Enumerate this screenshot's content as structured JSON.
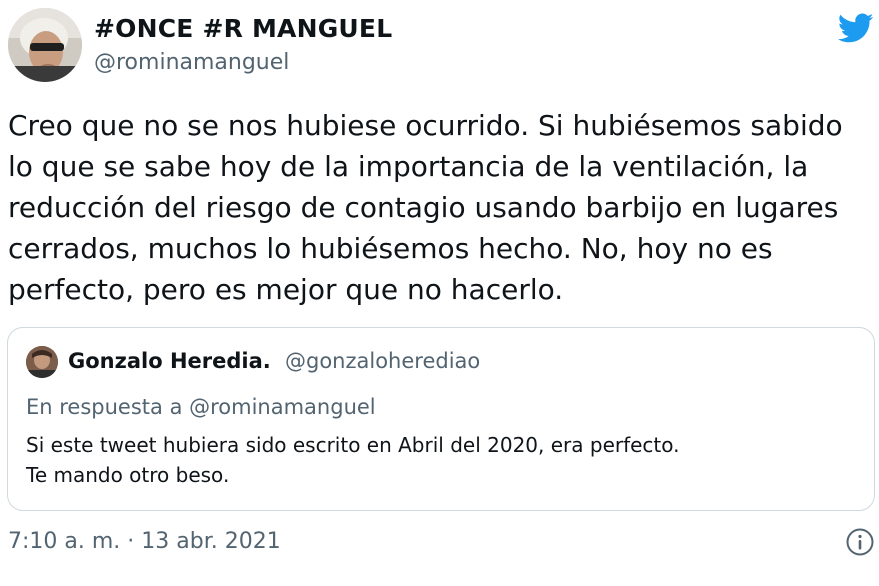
{
  "author": {
    "display_name": "#ONCE #R MANGUEL",
    "handle": "@rominamanguel"
  },
  "tweet": {
    "text": "Creo que no se nos hubiese ocurrido. Si hubiésemos sabido\nlo que se sabe hoy de la importancia de la ventilación, la\nreducción del riesgo de contagio usando barbijo en lugares\ncerrados, muchos lo hubiésemos hecho. No, hoy no es\nperfecto, pero es mejor que no hacerlo.",
    "timestamp": "7:10 a. m. · 13 abr. 2021"
  },
  "quoted_tweet": {
    "display_name": "Gonzalo Heredia.",
    "handle": "@gonzaloherediao",
    "reply_context": "En respuesta a @rominamanguel",
    "text": "Si este tweet hubiera sido escrito en Abril del 2020, era perfecto.\nTe mando otro beso."
  },
  "icons": {
    "logo": "twitter-bird-icon",
    "info": "info-icon"
  },
  "colors": {
    "brand": "#1d9bf0",
    "secondary_text": "#536471",
    "border": "#cfd9de"
  }
}
